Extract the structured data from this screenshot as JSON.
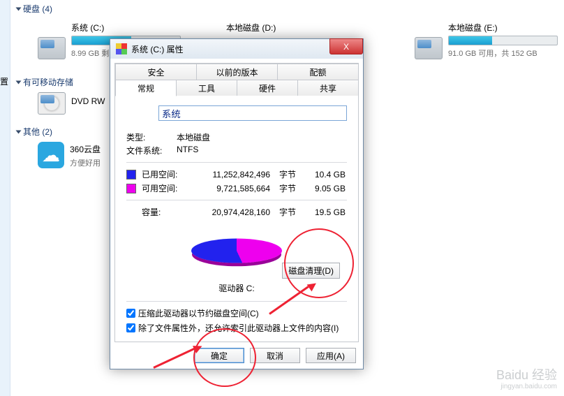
{
  "explorer": {
    "groups": {
      "drives_header": "硬盘 (4)",
      "removable_header": "有可移动存储",
      "other_header": "其他 (2)"
    },
    "drives": {
      "c": {
        "name": "系统 (C:)",
        "sub": "8.99 GB 剩",
        "fill_pct": 55
      },
      "d": {
        "name": "本地磁盘 (D:)",
        "sub": "",
        "fill_pct": 0
      },
      "e": {
        "name": "本地磁盘 (E:)",
        "sub": "91.0 GB 可用，共 152 GB",
        "fill_pct": 40
      }
    },
    "dvd": {
      "name": "DVD RW"
    },
    "cloud": {
      "name": "360云盘",
      "sub": "方便好用"
    },
    "settings_link": "置"
  },
  "dialog": {
    "title": "系统 (C:) 属性",
    "close_icon": "X",
    "tabs_top": [
      "安全",
      "以前的版本",
      "配额"
    ],
    "tabs_bottom": [
      "常规",
      "工具",
      "硬件",
      "共享"
    ],
    "name_value": "系统",
    "type_label": "类型:",
    "type_value": "本地磁盘",
    "fs_label": "文件系统:",
    "fs_value": "NTFS",
    "used_label": "已用空间:",
    "used_bytes": "11,252,842,496",
    "unit": "字节",
    "used_gb": "10.4 GB",
    "free_label": "可用空间:",
    "free_bytes": "9,721,585,664",
    "free_gb": "9.05 GB",
    "cap_label": "容量:",
    "cap_bytes": "20,974,428,160",
    "cap_gb": "19.5 GB",
    "drive_label": "驱动器 C:",
    "cleanup_btn": "磁盘清理(D)",
    "compress_label": "压缩此驱动器以节约磁盘空间(C)",
    "index_label": "除了文件属性外，还允许索引此驱动器上文件的内容(I)",
    "ok_btn": "确定",
    "cancel_btn": "取消",
    "apply_btn": "应用(A)"
  },
  "watermark": {
    "brand": "Baidu 经验",
    "url": "jingyan.baidu.com"
  }
}
